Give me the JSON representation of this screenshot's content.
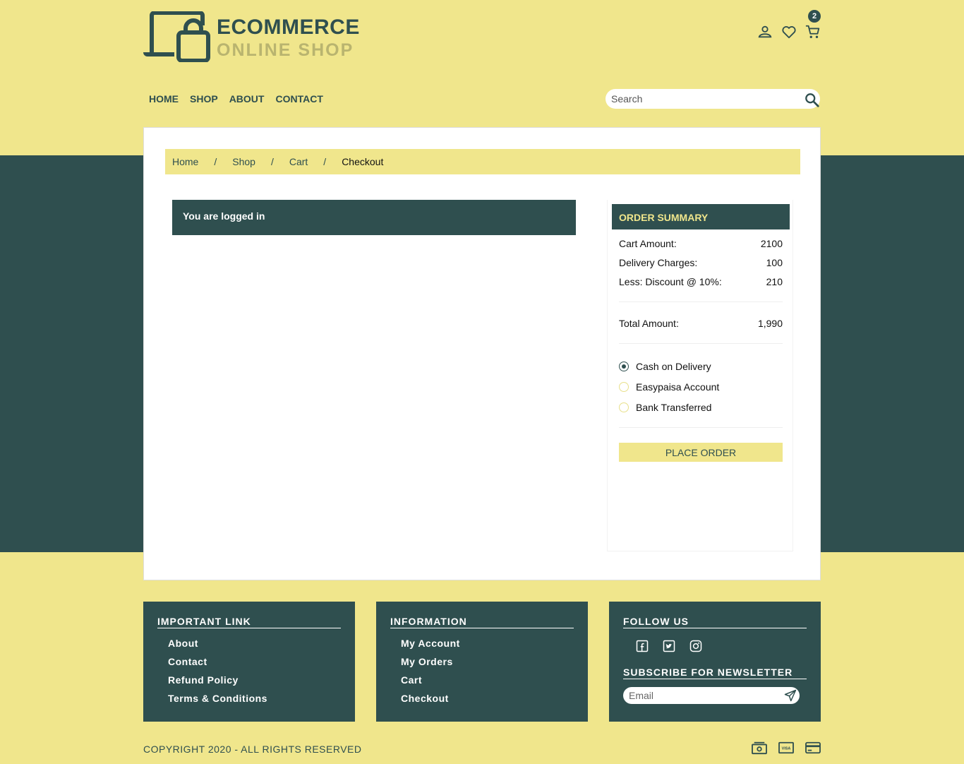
{
  "brand": {
    "name": "ECOMMERCE",
    "tagline": "ONLINE SHOP"
  },
  "header": {
    "cart_count": "2"
  },
  "nav": {
    "items": [
      "HOME",
      "SHOP",
      "ABOUT",
      "CONTACT"
    ]
  },
  "search": {
    "placeholder": "Search"
  },
  "breadcrumb": {
    "items": [
      "Home",
      "Shop",
      "Cart"
    ],
    "separator": "/",
    "current": "Checkout"
  },
  "login_status": "You are logged in",
  "order_summary": {
    "title": "ORDER SUMMARY",
    "rows": [
      {
        "label": "Cart Amount:",
        "value": "2100"
      },
      {
        "label": "Delivery Charges:",
        "value": "100"
      },
      {
        "label": "Less: Discount @ 10%:",
        "value": "210"
      }
    ],
    "total": {
      "label": "Total Amount:",
      "value": "1,990"
    },
    "payment_methods": [
      "Cash on Delivery",
      "Easypaisa Account",
      "Bank Transferred"
    ],
    "selected_payment": "Cash on Delivery",
    "place_order_label": "PLACE ORDER"
  },
  "footer": {
    "important_links": {
      "title": "IMPORTANT LINK",
      "items": [
        "About",
        "Contact",
        "Refund Policy",
        "Terms & Conditions"
      ]
    },
    "information": {
      "title": "INFORMATION",
      "items": [
        "My Account",
        "My Orders",
        "Cart",
        "Checkout"
      ]
    },
    "follow_us": {
      "title": "FOLLOW US",
      "icons": [
        "facebook-icon",
        "twitter-icon",
        "instagram-icon"
      ]
    },
    "newsletter": {
      "title": "SUBSCRIBE FOR NEWSLETTER",
      "placeholder": "Email"
    },
    "copyright": "COPYRIGHT 2020 - ALL RIGHTS RESERVED",
    "payment_icons": [
      "cash-icon",
      "visa-icon",
      "credit-card-icon"
    ]
  },
  "colors": {
    "primary": "#2f4f4f",
    "accent": "#f0e68c",
    "muted": "#b9b46f"
  }
}
